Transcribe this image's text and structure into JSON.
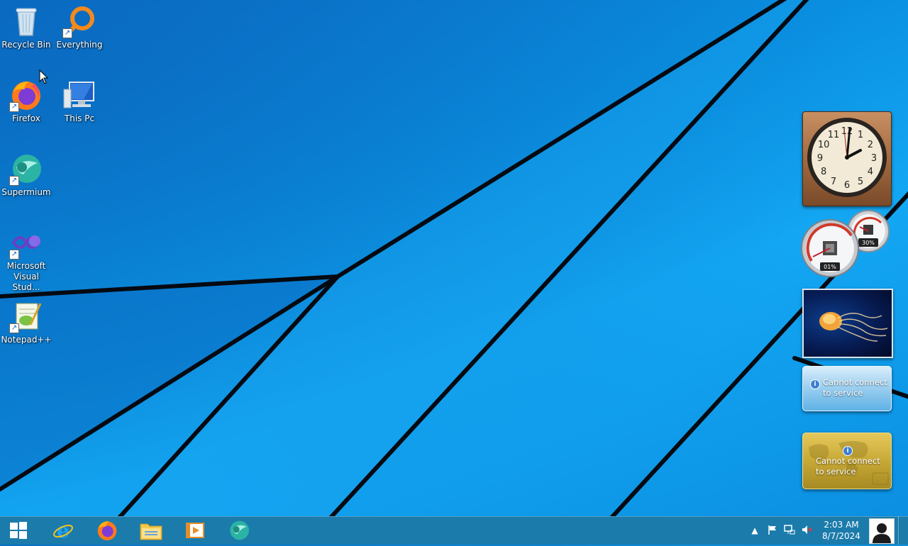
{
  "desktop": {
    "icons": [
      {
        "label": "Recycle Bin",
        "icon": "recycle-bin-icon"
      },
      {
        "label": "Everything",
        "icon": "everything-search-icon"
      },
      {
        "label": "Firefox",
        "icon": "firefox-icon"
      },
      {
        "label": "This Pc",
        "icon": "this-pc-icon"
      },
      {
        "label": "Supermium",
        "icon": "supermium-icon"
      },
      {
        "label": "Microsoft Visual Stud...",
        "icon": "visual-studio-icon"
      },
      {
        "label": "Notepad++",
        "icon": "notepadpp-icon"
      }
    ]
  },
  "gadgets": {
    "clock": {
      "numerals": [
        "12",
        "1",
        "2",
        "3",
        "4",
        "5",
        "6",
        "7",
        "8",
        "9",
        "10",
        "11"
      ]
    },
    "cpu_meter": {
      "cpu_value": "01%",
      "ram_value": "30%"
    },
    "weather": {
      "message": "Cannot connect to service"
    },
    "currency": {
      "message": "Cannot connect to service"
    }
  },
  "taskbar": {
    "pinned": [
      {
        "name": "internet-explorer-icon"
      },
      {
        "name": "firefox-icon"
      },
      {
        "name": "file-explorer-icon"
      },
      {
        "name": "media-player-icon"
      },
      {
        "name": "supermium-icon"
      }
    ],
    "tray": {
      "expander": "▲",
      "time": "2:03 AM",
      "date": "8/7/2024"
    }
  },
  "colors": {
    "taskbar": "#1b7bab",
    "wallpaper": "#0a8fe0",
    "accent": "#13a7f3"
  }
}
